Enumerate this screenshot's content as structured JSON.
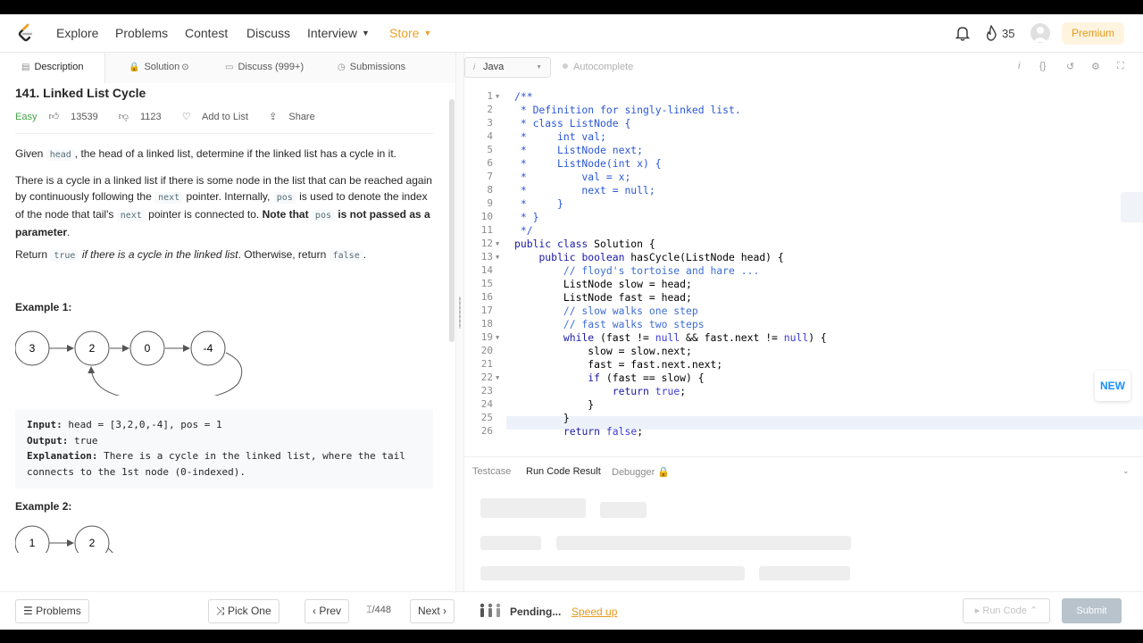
{
  "nav": {
    "links": [
      "Explore",
      "Problems",
      "Contest",
      "Discuss",
      "Interview",
      "Store"
    ],
    "streak": "35",
    "premium": "Premium",
    "store_color": "#e9a22a"
  },
  "tabs": {
    "description": "Description",
    "solution": "Solution",
    "discuss": "Discuss (999+)",
    "submissions": "Submissions"
  },
  "problem": {
    "title": "141. Linked List Cycle",
    "difficulty": "Easy",
    "likes": "13539",
    "dislikes": "1123",
    "add_to_list": "Add to List",
    "share": "Share",
    "p1_a": "Given",
    "p1_code": "head",
    "p1_b": ", the head of a linked list, determine if the linked list has a cycle in it.",
    "p2_a": "There is a cycle in a linked list if there is some node in the list that can be reached again by continuously following the",
    "p2_code1": "next",
    "p2_b": "pointer. Internally,",
    "p2_code2": "pos",
    "p2_c": "is used to denote the index of the node that tail's",
    "p2_code3": "next",
    "p2_d": "pointer is connected to.",
    "p2_bold1": "Note that",
    "p2_code4": "pos",
    "p2_bold2": "is not passed as a parameter",
    "p2_end": ".",
    "p3_a": "Return",
    "p3_code1": "true",
    "p3_italic": "if there is a cycle in the linked list",
    "p3_b": ". Otherwise, return",
    "p3_code2": "false",
    "p3_end": ".",
    "example1_title": "Example 1:",
    "example1_nodes": [
      "3",
      "2",
      "0",
      "-4"
    ],
    "example1_input_label": "Input:",
    "example1_input": "head = [3,2,0,-4], pos = 1",
    "example1_output_label": "Output:",
    "example1_output": "true",
    "example1_expl_label": "Explanation:",
    "example1_expl": "There is a cycle in the linked list, where the tail connects to the 1st node (0-indexed).",
    "example2_title": "Example 2:",
    "example2_nodes": [
      "1",
      "2"
    ]
  },
  "editor": {
    "language": "Java",
    "autocomplete": "Autocomplete",
    "new_badge": "NEW"
  },
  "results": {
    "tabs": [
      "Testcase",
      "Run Code Result",
      "Debugger"
    ]
  },
  "bottom": {
    "problems": "Problems",
    "pick_one": "Pick One",
    "prev": "Prev",
    "pager": "/448",
    "next": "Next",
    "pending": "Pending...",
    "speed_up": "Speed up",
    "run_code": "Run Code",
    "submit": "Submit"
  }
}
